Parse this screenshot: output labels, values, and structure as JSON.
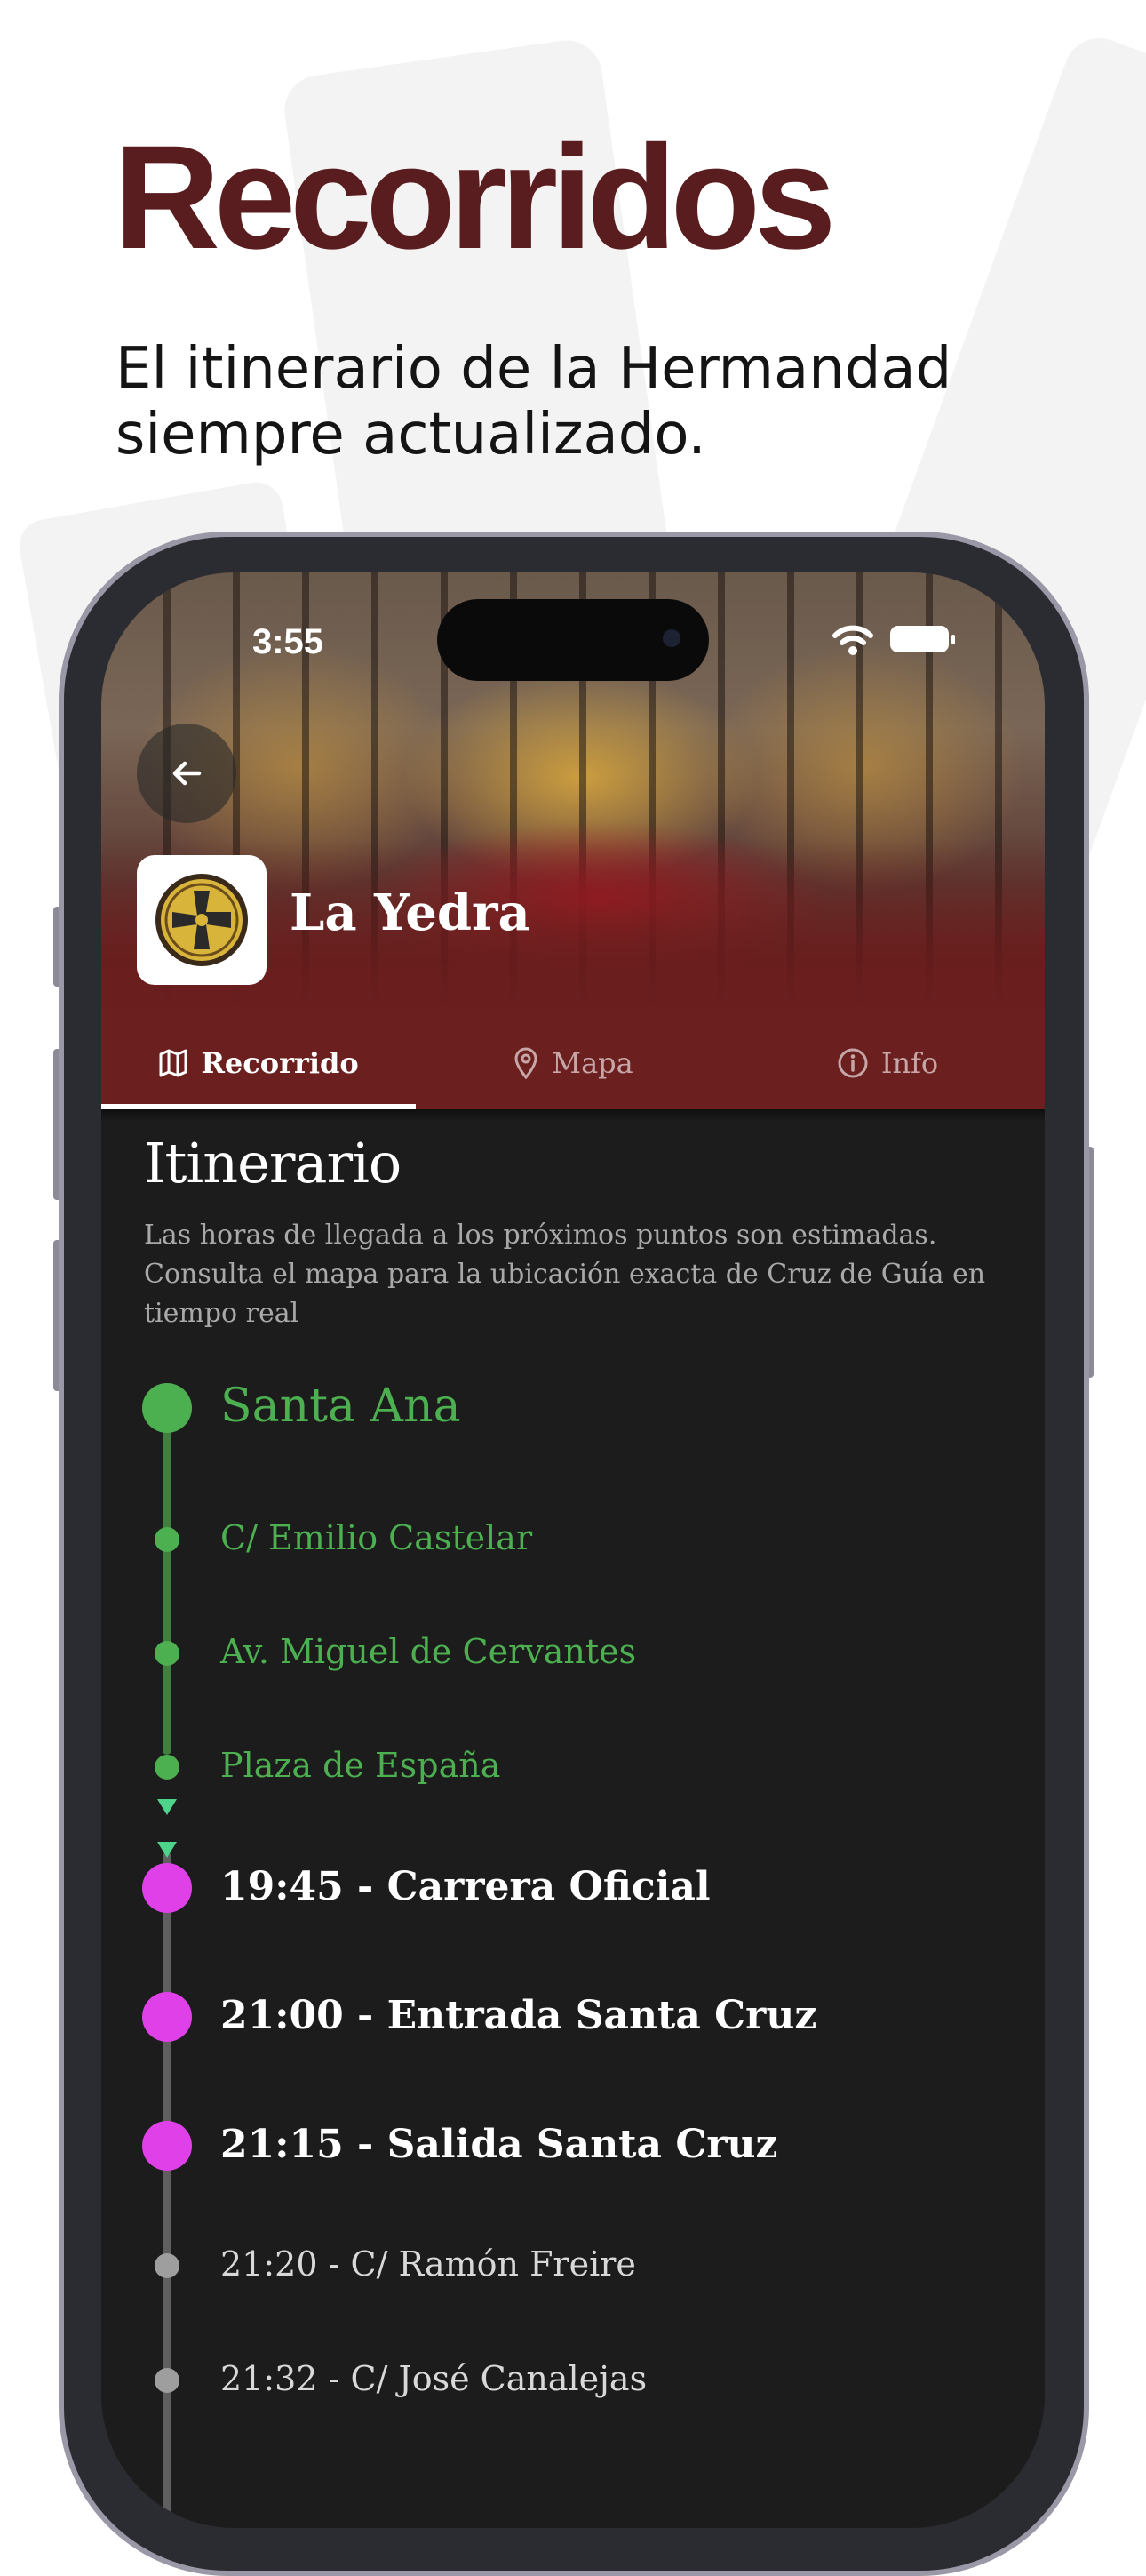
{
  "promo": {
    "title": "Recorridos",
    "subtitle": "El itinerario de la Hermandad siempre actualizado."
  },
  "status_bar": {
    "time": "3:55"
  },
  "header": {
    "brotherhood_name": "La Yedra"
  },
  "tabs": [
    {
      "label": "Recorrido",
      "icon": "map-icon",
      "active": true
    },
    {
      "label": "Mapa",
      "icon": "location-pin-icon",
      "active": false
    },
    {
      "label": "Info",
      "icon": "info-icon",
      "active": false
    }
  ],
  "itinerary": {
    "title": "Itinerario",
    "note": "Las horas de llegada a los próximos puntos son estimadas. Consulta el mapa para la ubicación exacta de Cruz de Guía en tiempo real",
    "stops": [
      {
        "label": "Santa Ana",
        "state": "passed",
        "major": true
      },
      {
        "label": "C/ Emilio Castelar",
        "state": "passed",
        "major": false
      },
      {
        "label": "Av. Miguel de Cervantes",
        "state": "passed",
        "major": false
      },
      {
        "label": "Plaza de España",
        "state": "passed",
        "major": false
      },
      {
        "label": "19:45 - Carrera Oficial",
        "state": "highlight",
        "major": true
      },
      {
        "label": "21:00 - Entrada Santa Cruz",
        "state": "highlight",
        "major": true
      },
      {
        "label": "21:15 - Salida Santa Cruz",
        "state": "highlight",
        "major": true
      },
      {
        "label": "21:20 - C/ Ramón Freire",
        "state": "upcoming",
        "major": false
      },
      {
        "label": "21:32 - C/ José Canalejas",
        "state": "upcoming",
        "major": false
      }
    ]
  },
  "colors": {
    "brand_maroon": "#5a1d1f",
    "passed_green": "#4caf50",
    "highlight_magenta": "#e040e8",
    "upcoming_grey": "#9e9e9e"
  }
}
